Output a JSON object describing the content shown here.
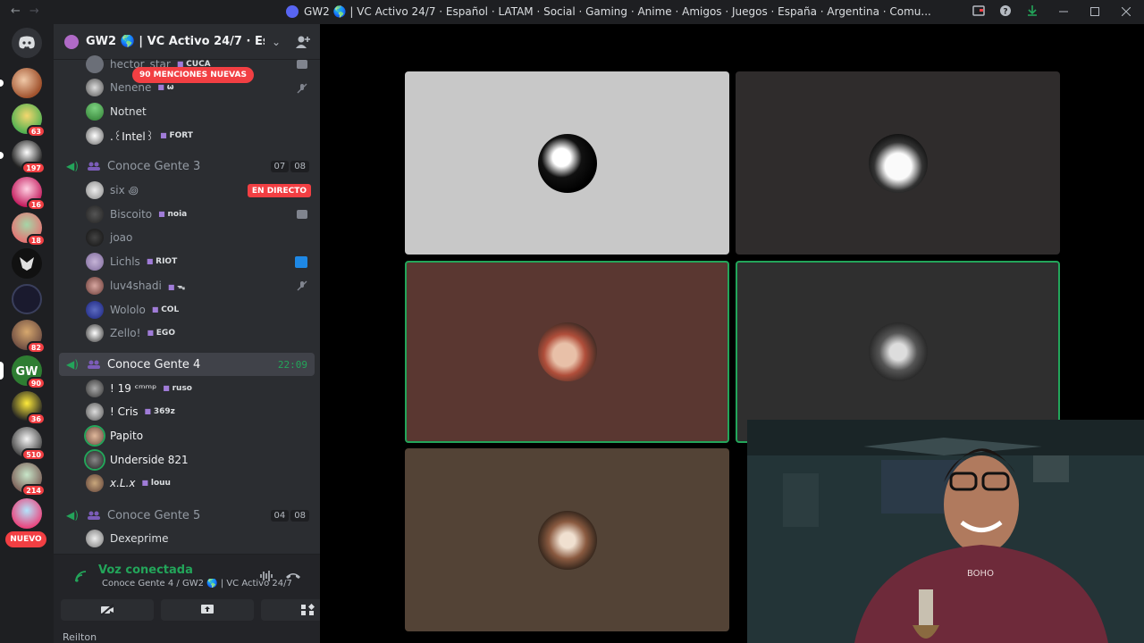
{
  "window": {
    "title": "GW2 🌎 | VC Activo 24/7 · Español · LATAM · Social · Gaming · Anime · Amigos · Juegos · España · Argentina · Comu...",
    "back_icon": "←",
    "forward_icon": "→",
    "controls": [
      "inbox-icon",
      "help-icon",
      "download-icon",
      "minimize",
      "maximize",
      "close"
    ]
  },
  "guilds": {
    "items": [
      {
        "name": "home"
      },
      {
        "name": "guild-1"
      },
      {
        "name": "guild-2",
        "badge": "63"
      },
      {
        "name": "guild-3",
        "badge": "197"
      },
      {
        "name": "guild-4",
        "badge": "16"
      },
      {
        "name": "guild-5",
        "badge": "18"
      },
      {
        "name": "guild-6"
      },
      {
        "name": "guild-7"
      },
      {
        "name": "guild-8",
        "badge": "82"
      },
      {
        "name": "guild-9",
        "badge": "90"
      },
      {
        "name": "guild-10",
        "badge": "36"
      },
      {
        "name": "guild-11",
        "badge": "510"
      },
      {
        "name": "guild-12",
        "badge": "214"
      },
      {
        "name": "guild-13"
      }
    ],
    "nuevo_label": "NUEVO"
  },
  "server": {
    "name": "GW2 🌎 | VC Activo 24/7 · Espa..."
  },
  "mentions_pill": "90 MENCIONES NUEVAS",
  "members_top": [
    {
      "name": "hector_star",
      "tag": "CUCA"
    },
    {
      "name": "Nenene",
      "tag": "ω"
    },
    {
      "name": "Notnet",
      "tag": ""
    },
    {
      "name": ".꒰Intel꒱",
      "tag": "FORT"
    }
  ],
  "channel3": {
    "name": "Conoce Gente 3",
    "count_a": "07",
    "count_b": "08",
    "live_label": "EN DIRECTO",
    "members": [
      {
        "name": "six ꩜",
        "tag": ""
      },
      {
        "name": "Biscoito",
        "tag": "noia"
      },
      {
        "name": "joao",
        "tag": ""
      },
      {
        "name": "Lichls",
        "tag": "RIOT"
      },
      {
        "name": "luv4shadi",
        "tag": "ᯓ"
      },
      {
        "name": "Wololo",
        "tag": "COL"
      },
      {
        "name": "Zello!",
        "tag": "EGO"
      }
    ]
  },
  "channel4": {
    "name": "Conoce Gente 4",
    "timer": "22:09",
    "members": [
      {
        "name": "! 19 ᶜᵐᵐᵖ",
        "tag": "ruso"
      },
      {
        "name": "! Cris",
        "tag": "369z"
      },
      {
        "name": "Papito",
        "tag": ""
      },
      {
        "name": "Underside 821",
        "tag": ""
      },
      {
        "name": "x.L.x",
        "tag": "louu"
      }
    ]
  },
  "channel5": {
    "name": "Conoce Gente 5",
    "count_a": "04",
    "count_b": "08",
    "members": [
      {
        "name": "Dexeprime",
        "tag": ""
      }
    ]
  },
  "voice_panel": {
    "status": "Voz conectada",
    "subtitle": "Conoce Gente 4 / GW2 🌎 | VC Activo 24/7...",
    "user": "Reilton"
  },
  "colors": {
    "accent_green": "#23a55a",
    "mention_red": "#f23f43",
    "sidebar_bg": "#2b2d31",
    "tile_grey": "#c8c8c8",
    "tile_dark": "#2f2c2c",
    "tile_red": "#5a3731",
    "tile_brown": "#534336"
  }
}
